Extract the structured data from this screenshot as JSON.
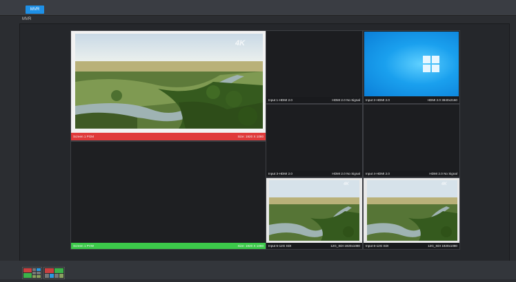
{
  "top_tab": {
    "label": "MVR"
  },
  "section_title": "MVR",
  "screens": [
    {
      "label": "Screen 1 PGM",
      "size": "Size: 1920 X 1080",
      "color": "#e03a3a"
    },
    {
      "label": "Screen 1 PVW",
      "size": "Size: 1920 X 1080",
      "color": "#3cc94a"
    }
  ],
  "pgm_badge": "4K",
  "inputs": [
    {
      "name": "Input 1-HDMI 2.0",
      "status": "HDMI 2.0 No Signal"
    },
    {
      "name": "Input 2-HDMI 2.0",
      "status": "HDMI 2.0 3840x2160"
    },
    {
      "name": "Input 3-HDMI 2.0",
      "status": "HDMI 2.0 No Signal"
    },
    {
      "name": "Input 4-HDMI 2.0",
      "status": "HDMI 2.0 No Signal"
    },
    {
      "name": "Input 5-12G SDI",
      "status": "12G_SDI 1920x1080"
    },
    {
      "name": "Input 6-12G SDI",
      "status": "12G_SDI 1920x1080"
    }
  ],
  "icons": [
    "windows-logo-icon",
    "layout-thumbnail-icon"
  ]
}
